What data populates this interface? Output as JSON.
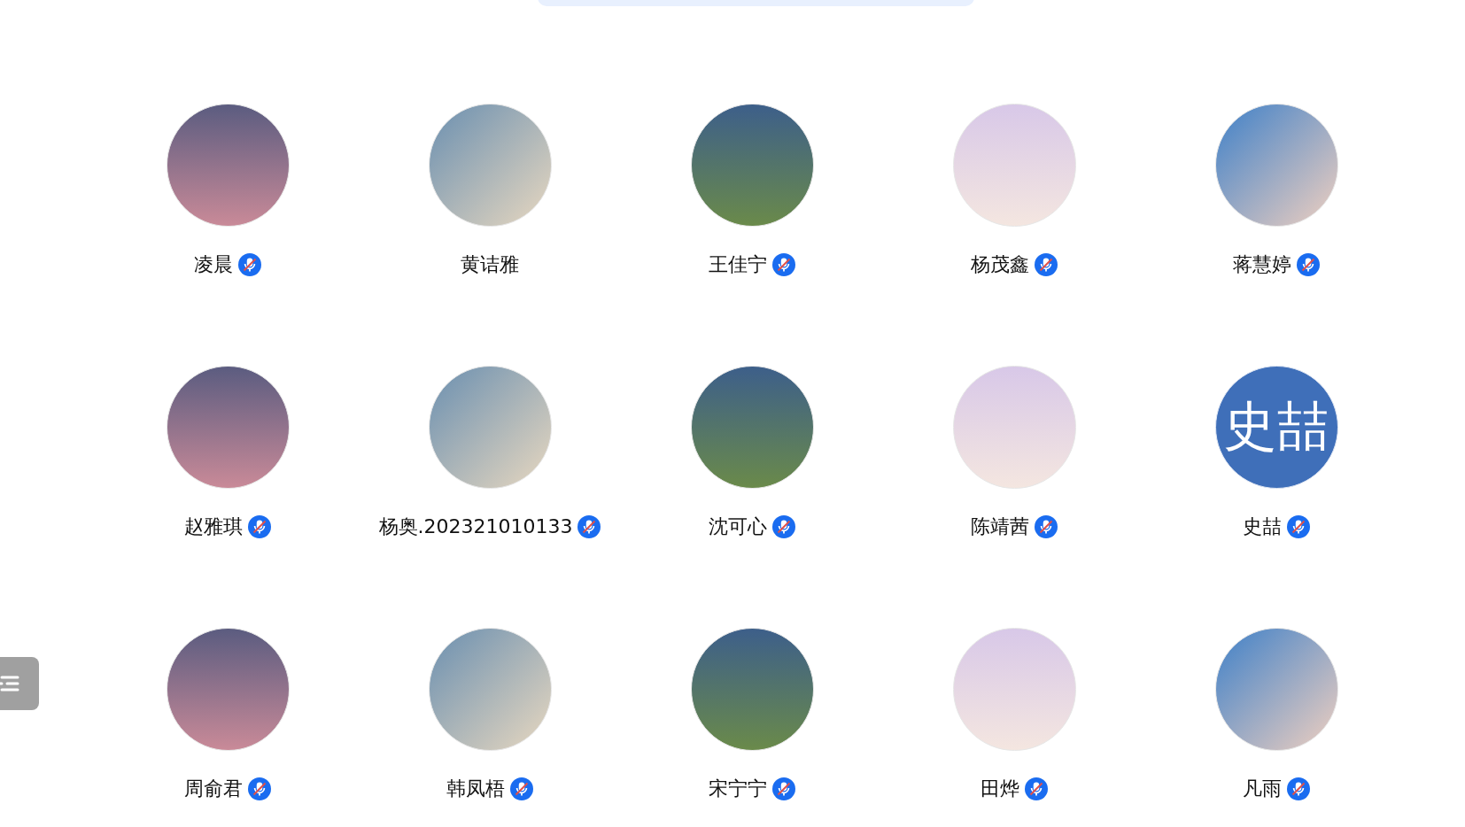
{
  "participants": [
    {
      "name": "凌晨",
      "muted": true,
      "avatar": {
        "kind": "photo"
      }
    },
    {
      "name": "黄诘雅",
      "muted": false,
      "avatar": {
        "kind": "photo"
      }
    },
    {
      "name": "王佳宁",
      "muted": true,
      "avatar": {
        "kind": "photo"
      }
    },
    {
      "name": "杨茂鑫",
      "muted": true,
      "avatar": {
        "kind": "photo"
      }
    },
    {
      "name": "蒋慧婷",
      "muted": true,
      "avatar": {
        "kind": "photo"
      }
    },
    {
      "name": "赵雅琪",
      "muted": true,
      "avatar": {
        "kind": "photo"
      }
    },
    {
      "name": "杨奥.202321010133",
      "muted": true,
      "avatar": {
        "kind": "photo"
      }
    },
    {
      "name": "沈可心",
      "muted": true,
      "avatar": {
        "kind": "photo"
      }
    },
    {
      "name": "陈靖茜",
      "muted": true,
      "avatar": {
        "kind": "photo"
      }
    },
    {
      "name": "史喆",
      "muted": true,
      "avatar": {
        "kind": "initials",
        "text": "史喆"
      }
    },
    {
      "name": "周俞君",
      "muted": true,
      "avatar": {
        "kind": "photo"
      }
    },
    {
      "name": "韩凤梧",
      "muted": true,
      "avatar": {
        "kind": "photo"
      }
    },
    {
      "name": "宋宁宁",
      "muted": true,
      "avatar": {
        "kind": "photo"
      }
    },
    {
      "name": "田烨",
      "muted": true,
      "avatar": {
        "kind": "photo"
      }
    },
    {
      "name": "凡雨",
      "muted": true,
      "avatar": {
        "kind": "photo"
      }
    }
  ]
}
